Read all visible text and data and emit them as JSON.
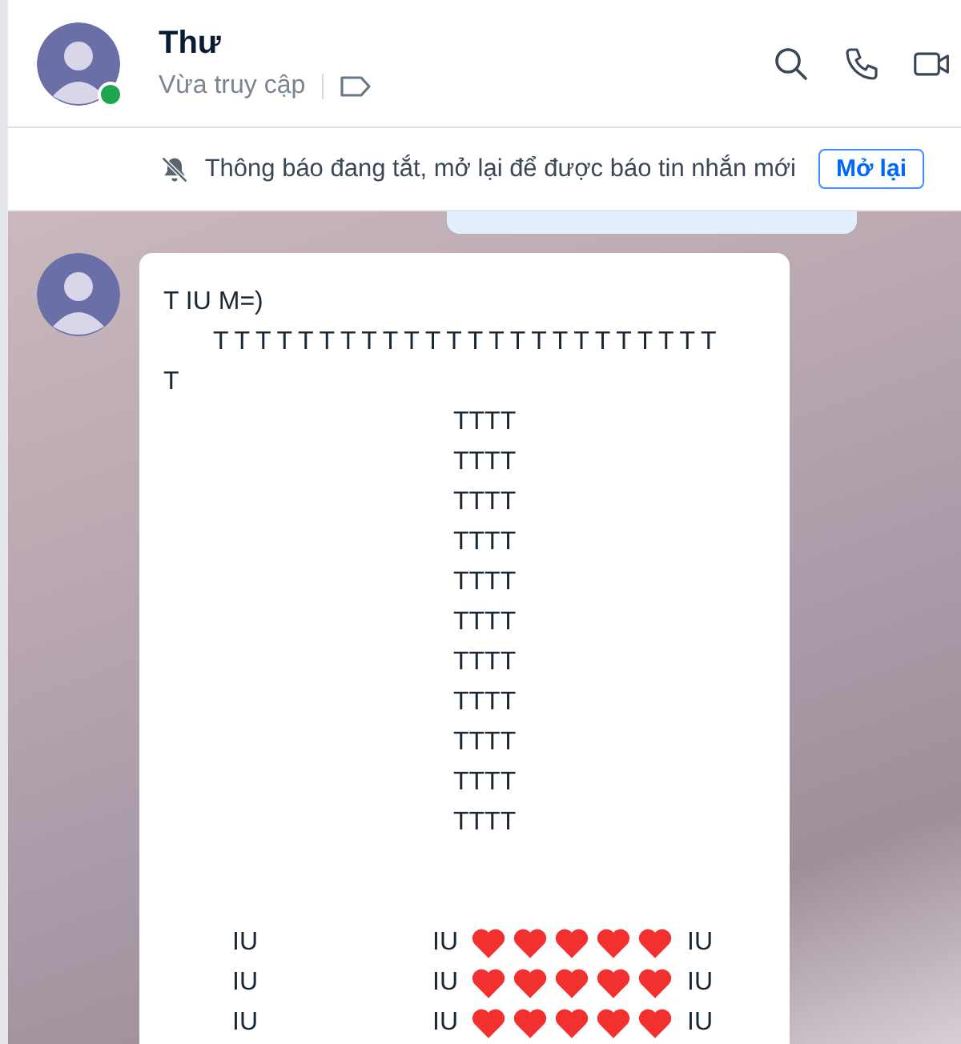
{
  "contact": {
    "name": "Thư",
    "status": "Vừa truy cập",
    "online": true
  },
  "notice": {
    "text": "Thông báo đang tắt, mở lại để được báo tin nhắn mới",
    "button": "Mở lại"
  },
  "message": {
    "lines": [
      {
        "kind": "caption",
        "segments": [
          {
            "kind": "text",
            "text": "T IU M=)"
          }
        ]
      },
      {
        "kind": "bar",
        "segments": [
          {
            "kind": "text",
            "text": "T T T T T T T T T T T T T T T T T T T T T T T T"
          }
        ]
      },
      {
        "kind": "caption",
        "segments": [
          {
            "kind": "text",
            "text": "T"
          }
        ]
      },
      {
        "kind": "stem",
        "segments": [
          {
            "kind": "text",
            "text": "TTTT"
          }
        ]
      },
      {
        "kind": "stem",
        "segments": [
          {
            "kind": "text",
            "text": "TTTT"
          }
        ]
      },
      {
        "kind": "stem",
        "segments": [
          {
            "kind": "text",
            "text": "TTTT"
          }
        ]
      },
      {
        "kind": "stem",
        "segments": [
          {
            "kind": "text",
            "text": "TTTT"
          }
        ]
      },
      {
        "kind": "stem",
        "segments": [
          {
            "kind": "text",
            "text": "TTTT"
          }
        ]
      },
      {
        "kind": "stem",
        "segments": [
          {
            "kind": "text",
            "text": "TTTT"
          }
        ]
      },
      {
        "kind": "stem",
        "segments": [
          {
            "kind": "text",
            "text": "TTTT"
          }
        ]
      },
      {
        "kind": "stem",
        "segments": [
          {
            "kind": "text",
            "text": "TTTT"
          }
        ]
      },
      {
        "kind": "stem",
        "segments": [
          {
            "kind": "text",
            "text": "TTTT"
          }
        ]
      },
      {
        "kind": "stem",
        "segments": [
          {
            "kind": "text",
            "text": "TTTT"
          }
        ]
      },
      {
        "kind": "stem",
        "segments": [
          {
            "kind": "text",
            "text": "TTTT"
          }
        ]
      },
      {
        "kind": "blank"
      },
      {
        "kind": "hearts",
        "segments": [
          {
            "kind": "text",
            "text": "IU"
          },
          {
            "kind": "text",
            "text": "IU"
          },
          {
            "kind": "heart"
          },
          {
            "kind": "heart"
          },
          {
            "kind": "heart"
          },
          {
            "kind": "heart"
          },
          {
            "kind": "heart"
          },
          {
            "kind": "text",
            "text": "IU"
          }
        ]
      },
      {
        "kind": "hearts",
        "segments": [
          {
            "kind": "text",
            "text": "IU"
          },
          {
            "kind": "text",
            "text": "IU"
          },
          {
            "kind": "heart"
          },
          {
            "kind": "heart"
          },
          {
            "kind": "heart"
          },
          {
            "kind": "heart"
          },
          {
            "kind": "heart"
          },
          {
            "kind": "text",
            "text": "IU"
          }
        ]
      },
      {
        "kind": "hearts",
        "segments": [
          {
            "kind": "text",
            "text": "IU"
          },
          {
            "kind": "text",
            "text": "IU"
          },
          {
            "kind": "heart"
          },
          {
            "kind": "heart"
          },
          {
            "kind": "heart"
          },
          {
            "kind": "heart"
          },
          {
            "kind": "heart"
          },
          {
            "kind": "text",
            "text": "IU"
          }
        ]
      }
    ]
  }
}
